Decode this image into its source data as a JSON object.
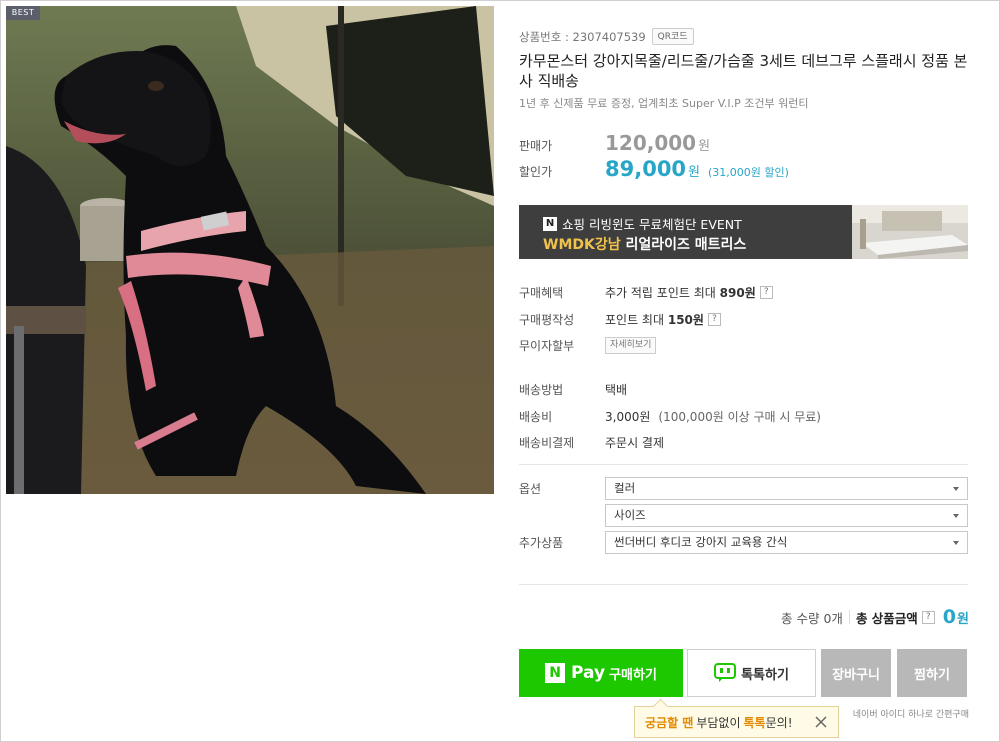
{
  "badge": "BEST",
  "product": {
    "number_text": "상품번호 : 2307407539",
    "qr_label": "QR코드",
    "title": "카무몬스터 강아지목줄/리드줄/가슴줄 3세트 데브그루 스플래시 정품 본사 직배송",
    "subtitle": "1년 후 신제품 무료 증정, 업계최초 Super V.I.P 조건부 워런티"
  },
  "price": {
    "original_label": "판매가",
    "original_value": "120,000",
    "original_unit": "원",
    "sale_label": "할인가",
    "sale_value": "89,000",
    "sale_unit": "원",
    "discount_text": "(31,000원 할인)"
  },
  "banner": {
    "n_logo": "N",
    "line1": "쇼핑 리빙윈도 무료체험단 EVENT",
    "line2_highlight": "WMDK강남",
    "line2_rest": " 리얼라이즈 매트리스"
  },
  "benefits": {
    "purchase_benefit_label": "구매혜택",
    "purchase_benefit_prefix": "추가 적립 포인트 최대",
    "purchase_benefit_amount": "890원",
    "review_label": "구매평작성",
    "review_prefix": "포인트 최대",
    "review_amount": "150원",
    "installment_label": "무이자할부",
    "installment_button": "자세히보기",
    "help_icon": "?"
  },
  "shipping": {
    "method_label": "배송방법",
    "method_value": "택배",
    "fee_label": "배송비",
    "fee_value": "3,000원",
    "fee_note": "(100,000원 이상 구매 시 무료)",
    "payment_label": "배송비결제",
    "payment_value": "주문시 결제"
  },
  "options": {
    "option_label": "옵션",
    "select_color": "컬러",
    "select_size": "사이즈",
    "addon_label": "추가상품",
    "select_addon": "썬더버디 후디코 강아지 교육용 간식"
  },
  "summary": {
    "quantity_text": "총 수량 0개",
    "total_label": "총 상품금액",
    "total_value": "0",
    "total_unit": "원",
    "help_icon": "?"
  },
  "buttons": {
    "npay_n": "N",
    "npay_pay": "Pay",
    "npay_label": "구매하기",
    "talk_label": "톡톡하기",
    "cart_label": "장바구니",
    "wish_label": "찜하기"
  },
  "npay_note": "네이버 아이디 하나로 간편구매",
  "tooltip": {
    "part1": "궁금할 땐",
    "part2": "부담없이",
    "part3": "톡톡",
    "part4": "문의!"
  },
  "colors": {
    "accent_blue": "#27a6c8",
    "npay_green": "#1ec800",
    "disabled_gray": "#b8b8b8",
    "tooltip_orange": "#e28a00"
  },
  "icons": [
    "dog-product-photo",
    "help-icon",
    "talk-bubble-icon",
    "close-icon",
    "chevron-down-icon",
    "npay-logo-icon"
  ]
}
